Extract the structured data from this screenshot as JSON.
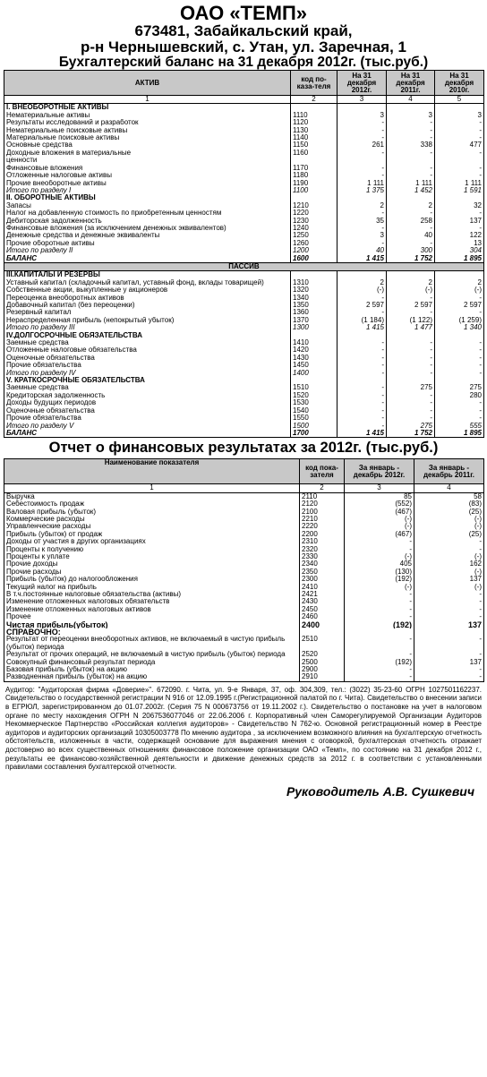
{
  "header": {
    "company": "ОАО «ТЕМП»",
    "address1": "673481, Забайкальский край,",
    "address2": "р-н Чернышевский, с. Утан, ул. Заречная, 1",
    "title": "Бухгалтерский баланс на 31 декабря 2012г. (тыс.руб.)"
  },
  "balance": {
    "col_name": "АКТИВ",
    "col_code": "код по-каза-теля",
    "col_y1": "На 31 декабря 2012г.",
    "col_y2": "На 31 декабря 2011г.",
    "col_y3": "На 31 декабря 2010г.",
    "colnums": [
      "1",
      "2",
      "3",
      "4",
      "5"
    ],
    "passiv": "ПАССИВ",
    "rows": [
      {
        "t": "sec",
        "n": "I. ВНЕОБОРОТНЫЕ АКТИВЫ",
        "c": "",
        "a": "",
        "b": "",
        "d": ""
      },
      {
        "t": "",
        "n": "Нематериальные активы",
        "c": "1110",
        "a": "3",
        "b": "3",
        "d": "3"
      },
      {
        "t": "",
        "n": "Результаты исследований и разработок",
        "c": "1120",
        "a": "-",
        "b": "-",
        "d": "-"
      },
      {
        "t": "",
        "n": "Нематериальные поисковые активы",
        "c": "1130",
        "a": "-",
        "b": "-",
        "d": "-"
      },
      {
        "t": "",
        "n": "Материальные поисковые активы",
        "c": "1140",
        "a": "-",
        "b": "-",
        "d": "-"
      },
      {
        "t": "",
        "n": "Основные средства",
        "c": "1150",
        "a": "261",
        "b": "338",
        "d": "477"
      },
      {
        "t": "",
        "n": "Доходные вложения в материальные",
        "c": "1160",
        "a": "-",
        "b": "-",
        "d": "-"
      },
      {
        "t": "",
        "n": "ценности",
        "c": "",
        "a": "",
        "b": "",
        "d": ""
      },
      {
        "t": "",
        "n": "Финансовые вложения",
        "c": "1170",
        "a": "-",
        "b": "-",
        "d": "-"
      },
      {
        "t": "",
        "n": "Отложенные налоговые активы",
        "c": "1180",
        "a": "-",
        "b": "-",
        "d": "-"
      },
      {
        "t": "",
        "n": "Прочие внеоборотные активы",
        "c": "1190",
        "a": "1 111",
        "b": "1 111",
        "d": "1 111"
      },
      {
        "t": "it",
        "n": "Итого по разделу I",
        "c": "1100",
        "a": "1 375",
        "b": "1 452",
        "d": "1 591"
      },
      {
        "t": "sec",
        "n": "II. ОБОРОТНЫЕ АКТИВЫ",
        "c": "",
        "a": "",
        "b": "",
        "d": ""
      },
      {
        "t": "",
        "n": "Запасы",
        "c": "1210",
        "a": "2",
        "b": "2",
        "d": "32"
      },
      {
        "t": "",
        "n": "Налог на добавленную стоимость по приобретенным ценностям",
        "c": "1220",
        "a": "-",
        "b": "-",
        "d": "-"
      },
      {
        "t": "",
        "n": "Дебиторская задолженность",
        "c": "1230",
        "a": "35",
        "b": "258",
        "d": "137"
      },
      {
        "t": "",
        "n": "Финансовые вложения (за исключением денежных эквивалентов)",
        "c": "1240",
        "a": "-",
        "b": "-",
        "d": "-"
      },
      {
        "t": "",
        "n": "Денежные средства и денежные эквиваленты",
        "c": "1250",
        "a": "3",
        "b": "40",
        "d": "122"
      },
      {
        "t": "",
        "n": "Прочие оборотные активы",
        "c": "1260",
        "a": "-",
        "b": "-",
        "d": "13"
      },
      {
        "t": "it",
        "n": "Итого по разделу II",
        "c": "1200",
        "a": "40",
        "b": "300",
        "d": "304"
      },
      {
        "t": "tot",
        "n": "БАЛАНС",
        "c": "1600",
        "a": "1 415",
        "b": "1 752",
        "d": "1 895"
      },
      {
        "t": "passiv",
        "n": "",
        "c": "",
        "a": "",
        "b": "",
        "d": ""
      },
      {
        "t": "sec",
        "n": "III.КАПИТАЛЫ И РЕЗЕРВЫ",
        "c": "",
        "a": "",
        "b": "",
        "d": ""
      },
      {
        "t": "",
        "n": "Уставный капитал (складочный капитал, уставный фонд, вклады товарищей)",
        "c": "1310",
        "a": "2",
        "b": "2",
        "d": "2"
      },
      {
        "t": "",
        "n": "Собственные акции, выкупленные у акционеров",
        "c": "1320",
        "a": "(-)",
        "b": "(-)",
        "d": "(-)"
      },
      {
        "t": "",
        "n": "Переоценка внеоборотных активов",
        "c": "1340",
        "a": "-",
        "b": "-",
        "d": "-"
      },
      {
        "t": "",
        "n": "Добавочный капитал (без переоценки)",
        "c": "1350",
        "a": "2 597",
        "b": "2 597",
        "d": "2 597"
      },
      {
        "t": "",
        "n": "Резервный капитал",
        "c": "1360",
        "a": "-",
        "b": "-",
        "d": "-"
      },
      {
        "t": "",
        "n": "Нераспределенная прибыль (непокрытый убыток)",
        "c": "1370",
        "a": "(1 184)",
        "b": "(1 122)",
        "d": "(1 259)"
      },
      {
        "t": "it",
        "n": "Итого по разделу III",
        "c": "1300",
        "a": "1 415",
        "b": "1 477",
        "d": "1 340"
      },
      {
        "t": "sec",
        "n": "IV.ДОЛГОСРОЧНЫЕ ОБЯЗАТЕЛЬСТВА",
        "c": "",
        "a": "",
        "b": "",
        "d": ""
      },
      {
        "t": "",
        "n": "Заемные средства",
        "c": "1410",
        "a": "-",
        "b": "-",
        "d": "-"
      },
      {
        "t": "",
        "n": "Отложенные налоговые обязательства",
        "c": "1420",
        "a": "-",
        "b": "-",
        "d": "-"
      },
      {
        "t": "",
        "n": "Оценочные обязательства",
        "c": "1430",
        "a": "-",
        "b": "-",
        "d": "-"
      },
      {
        "t": "",
        "n": "Прочие обязательства",
        "c": "1450",
        "a": "-",
        "b": "-",
        "d": "-"
      },
      {
        "t": "it",
        "n": "Итого по разделу IV",
        "c": "1400",
        "a": "-",
        "b": "-",
        "d": "-"
      },
      {
        "t": "sec",
        "n": "V. КРАТКОСРОЧНЫЕ ОБЯЗАТЕЛЬСТВА",
        "c": "",
        "a": "",
        "b": "",
        "d": ""
      },
      {
        "t": "",
        "n": "Заемные средства",
        "c": "1510",
        "a": "-",
        "b": "275",
        "d": "275"
      },
      {
        "t": "",
        "n": "Кредиторская задолженность",
        "c": "1520",
        "a": "-",
        "b": "-",
        "d": "280"
      },
      {
        "t": "",
        "n": "Доходы будущих периодов",
        "c": "1530",
        "a": "-",
        "b": "-",
        "d": "-"
      },
      {
        "t": "",
        "n": "Оценочные обязательства",
        "c": "1540",
        "a": "-",
        "b": "-",
        "d": "-"
      },
      {
        "t": "",
        "n": "Прочие обязательства",
        "c": "1550",
        "a": "-",
        "b": "-",
        "d": "-"
      },
      {
        "t": "it",
        "n": "Итого по разделу V",
        "c": "1500",
        "a": "-",
        "b": "275",
        "d": "555"
      },
      {
        "t": "tot",
        "n": "БАЛАНС",
        "c": "1700",
        "a": "1 415",
        "b": "1 752",
        "d": "1 895"
      }
    ]
  },
  "fin": {
    "title": "Отчет о финансовых результатах за 2012г. (тыс.руб.)",
    "col_name": "Наименование показателя",
    "col_code": "код пока-зателя",
    "col_y1": "За январь - декабрь 2012г.",
    "col_y2": "За январь - декабрь 2011г.",
    "colnums": [
      "1",
      "2",
      "3",
      "4"
    ],
    "rows": [
      {
        "t": "",
        "n": "Выручка",
        "c": "2110",
        "a": "85",
        "b": "58"
      },
      {
        "t": "",
        "n": "Себестоимость продаж",
        "c": "2120",
        "a": "(552)",
        "b": "(83)"
      },
      {
        "t": "",
        "n": "Валовая прибыль (убыток)",
        "c": "2100",
        "a": "(467)",
        "b": "(25)"
      },
      {
        "t": "",
        "n": "Коммерческие расходы",
        "c": "2210",
        "a": "(-)",
        "b": "(-)"
      },
      {
        "t": "",
        "n": "Управленческие расходы",
        "c": "2220",
        "a": "(-)",
        "b": "(-)"
      },
      {
        "t": "",
        "n": "Прибыль (убыток) от продаж",
        "c": "2200",
        "a": "(467)",
        "b": "(25)"
      },
      {
        "t": "",
        "n": "Доходы от участия в других организациях",
        "c": "2310",
        "a": "-",
        "b": "-"
      },
      {
        "t": "",
        "n": "Проценты к получению",
        "c": "2320",
        "a": "-",
        "b": "-"
      },
      {
        "t": "",
        "n": "Проценты к уплате",
        "c": "2330",
        "a": "(-)",
        "b": "(-)"
      },
      {
        "t": "",
        "n": "Прочие доходы",
        "c": "2340",
        "a": "405",
        "b": "162"
      },
      {
        "t": "",
        "n": "Прочие расходы",
        "c": "2350",
        "a": "(130)",
        "b": "(-)"
      },
      {
        "t": "",
        "n": "Прибыль (убыток) до налогообложения",
        "c": "2300",
        "a": "(192)",
        "b": "137"
      },
      {
        "t": "",
        "n": "Текущий налог на прибыль",
        "c": "2410",
        "a": "(-)",
        "b": "(-)"
      },
      {
        "t": "",
        "n": "В т.ч.постоянные налоговые обязательства (активы)",
        "c": "2421",
        "a": "-",
        "b": "-"
      },
      {
        "t": "",
        "n": "Изменение отложенных налоговых обязательств",
        "c": "2430",
        "a": "-",
        "b": "-"
      },
      {
        "t": "",
        "n": "Изменение отложенных налоговых активов",
        "c": "2450",
        "a": "-",
        "b": "-"
      },
      {
        "t": "",
        "n": "Прочее",
        "c": "2460",
        "a": "-",
        "b": "-"
      },
      {
        "t": "bold",
        "n": "Чистая прибыль(убыток)",
        "c": "2400",
        "a": "(192)",
        "b": "137"
      },
      {
        "t": "bold",
        "n": "СПРАВОЧНО:",
        "c": "",
        "a": "",
        "b": ""
      },
      {
        "t": "wrap",
        "n": "Результат от переоценки внеоборотных активов, не включаемый в чистую прибыль (убыток) периода",
        "c": "2510",
        "a": "-",
        "b": "-"
      },
      {
        "t": "wrap",
        "n": "Результат от прочих операций, не включаемый в чистую прибыль (убыток) периода",
        "c": "2520",
        "a": "-",
        "b": "-"
      },
      {
        "t": "",
        "n": "Совокупный финансовый результат периода",
        "c": "2500",
        "a": "(192)",
        "b": "137"
      },
      {
        "t": "",
        "n": "Базовая прибыль (убыток) на акцию",
        "c": "2900",
        "a": "-",
        "b": "-"
      },
      {
        "t": "",
        "n": "Разводненная прибыль (убыток) на акцию",
        "c": "2910",
        "a": "-",
        "b": "-"
      }
    ]
  },
  "audit": "Аудитор: \"Аудиторская фирма «Доверие»\". 672090. г. Чита, ул. 9-е Января, 37, оф. 304,309, тел.: (3022) 35-23-60 ОГРН 1027501162237. Свидетельство о государственной регистрации N 916 от 12.09.1995 г.(Регистрационной палатой по г. Чита). Свидетельство о внесении записи в ЕГРЮЛ, зарегистрированном до 01.07.2002г. (Серия 75 N 000673756 от 19.11.2002 г.). Свидетельство о постановке на учет в налоговом органе по месту нахождения ОГРН N 2067536077046 от 22.06.2006 г. Корпоративный член Саморегулируемой Организации Аудиторов Некоммерческое Партнерство «Российская коллегия аудиторов» - Свидетельство N 762-ю. Основной регистрационный номер в Реестре аудиторов и аудиторских организаций 10305003778 По мнению аудитора , за исключением возможного влияния на бухгалтерскую отчетность обстоятельств, изложенных в части, содержащей основание для выражения мнения с оговоркой, бухгалтерская отчетность отражает достоверно во всех существенных отношениях финансовое положение организации ОАО «Темп», по состоянию на 31 декабря 2012 г., результаты ее финансово-хозяйственной деятельности и движение денежных средств за 2012 г. в соответствии с установленными правилами составления бухгалтерской отчетности.",
  "signature": "Руководитель А.В. Сушкевич"
}
